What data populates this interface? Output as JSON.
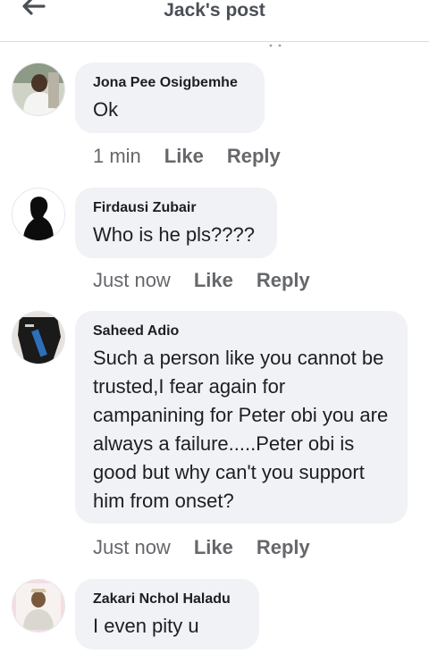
{
  "header": {
    "title": "Jack's post"
  },
  "comments": [
    {
      "author": "Jona Pee Osigbemhe",
      "text": "Ok",
      "time": "1 min",
      "like": "Like",
      "reply": "Reply"
    },
    {
      "author": "Firdausi Zubair",
      "text": "Who is he pls????",
      "time": "Just now",
      "like": "Like",
      "reply": "Reply"
    },
    {
      "author": "Saheed Adio",
      "text": "Such a person like you cannot be trusted,I fear again for campanining for Peter obi you are always a failure.....Peter obi is good but why can't you support him from onset?",
      "time": "Just now",
      "like": "Like",
      "reply": "Reply"
    },
    {
      "author": "Zakari Nchol Haladu",
      "text": "I even pity u"
    }
  ],
  "icons": {
    "back": "arrow-left-icon"
  },
  "colors": {
    "bubble": "#f0f2f5",
    "meta": "#65676b",
    "text": "#1c1e21"
  }
}
